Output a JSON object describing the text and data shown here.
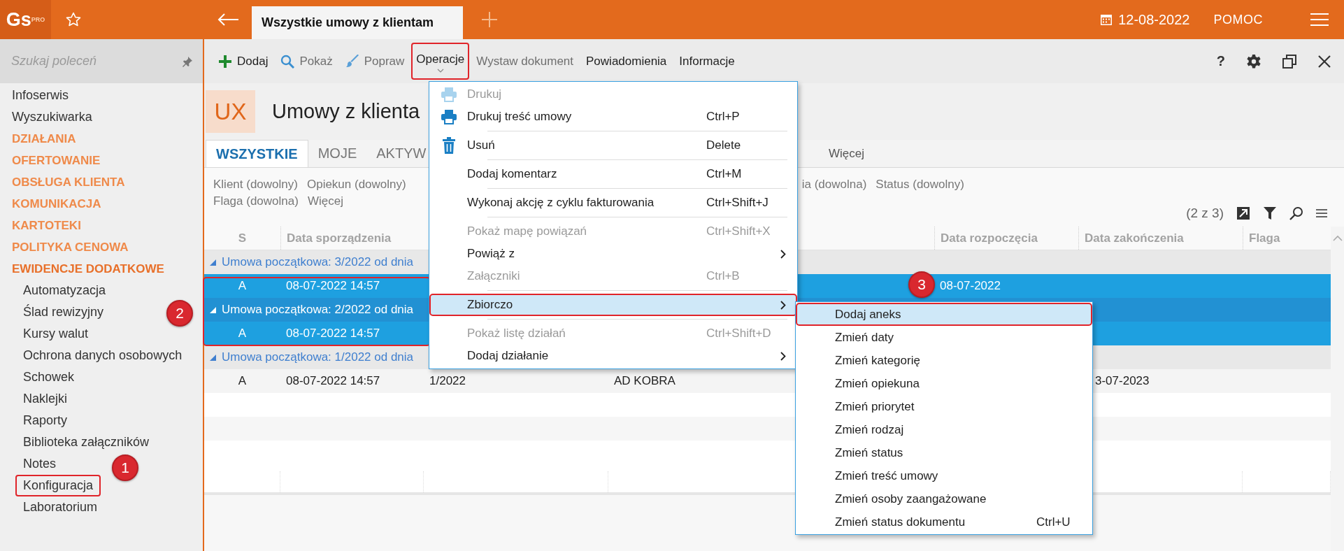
{
  "topbar": {
    "logo": "Gs$^{PRO}$",
    "tab": {
      "title": "Wszystkie umowy z klientam",
      "selected": true
    },
    "date": "12-08-2022",
    "help": "POMOC"
  },
  "sidebar": {
    "search": {
      "placeholder": "Szukaj poleceń"
    },
    "items": [
      {
        "kind": "link",
        "label": "Infoserwis"
      },
      {
        "kind": "link",
        "label": "Wyszukiwarka"
      },
      {
        "kind": "category",
        "label": "DZIAŁANIA",
        "expanded": false
      },
      {
        "kind": "category",
        "label": "OFERTOWANIE",
        "expanded": false
      },
      {
        "kind": "category",
        "label": "OBSŁUGA KLIENTA",
        "expanded": false
      },
      {
        "kind": "category",
        "label": "KOMUNIKACJA",
        "expanded": false
      },
      {
        "kind": "category",
        "label": "KARTOTEKI",
        "expanded": false
      },
      {
        "kind": "category",
        "label": "POLITYKA CENOWA",
        "expanded": false
      },
      {
        "kind": "category",
        "label": "EWIDENCJE DODATKOWE",
        "expanded": true,
        "children": [
          {
            "kind": "link",
            "label": "Automatyzacja",
            "outlined": false
          },
          {
            "kind": "link",
            "label": "Ślad rewizyjny",
            "outlined": false
          },
          {
            "kind": "link",
            "label": "Kursy walut",
            "outlined": false
          },
          {
            "kind": "link",
            "label": "Ochrona danych osobowych",
            "outlined": false
          },
          {
            "kind": "link",
            "label": "Schowek",
            "outlined": false
          },
          {
            "kind": "link",
            "label": "Naklejki",
            "outlined": false
          },
          {
            "kind": "link",
            "label": "Raporty",
            "outlined": false
          },
          {
            "kind": "link",
            "label": "Biblioteka załączników",
            "outlined": false
          },
          {
            "kind": "link",
            "label": "Notes",
            "outlined": false
          },
          {
            "kind": "link",
            "label": "Konfiguracja",
            "outlined": true
          },
          {
            "kind": "link",
            "label": "Laboratorium",
            "outlined": false
          }
        ]
      }
    ]
  },
  "toolbar": {
    "commands": [
      {
        "kind": "icon-command",
        "label": "Dodaj",
        "disabled": false,
        "outlined": false
      },
      {
        "kind": "icon-command",
        "label": "Pokaż",
        "disabled": true,
        "outlined": false
      },
      {
        "kind": "icon-command",
        "label": "Popraw",
        "disabled": true,
        "outlined": false
      },
      {
        "kind": "dropdown",
        "label": "Operacje",
        "disabled": false,
        "outlined": true
      },
      {
        "kind": "command",
        "label": "Wystaw dokument",
        "disabled": true,
        "outlined": false
      },
      {
        "kind": "command",
        "label": "Powiadomienia",
        "disabled": false,
        "outlined": false
      },
      {
        "kind": "command",
        "label": "Informacje",
        "disabled": false,
        "outlined": false
      }
    ],
    "help": "?"
  },
  "header": {
    "badge": "UX",
    "title": "Umowy z klienta"
  },
  "tabs": [
    {
      "label": "WSZYSTKIE",
      "selected": true
    },
    {
      "label": "MOJE",
      "selected": false
    },
    {
      "label": "AKTYW",
      "selected": false
    }
  ],
  "tabs_more": "Więcej",
  "filters": {
    "line_1": [
      "Klient (dowolny)",
      "Opiekun (dowolny)",
      "ia (dowolna)",
      "Status (dowolny)"
    ],
    "line_2": [
      "Flaga (dowolna)",
      "Więcej"
    ],
    "count": "(2 z 3)"
  },
  "table": {
    "columns": [
      "S",
      "Data sporządzenia",
      null,
      null,
      "Data rozpoczęcia",
      "Data zakończenia",
      "Flaga"
    ],
    "rows": [
      {
        "kind": "group",
        "label": "Umowa początkowa: 3/2022 od dnia",
        "selected": false
      },
      {
        "kind": "record",
        "selected": true,
        "cells": [
          "A",
          "08-07-2022 14:57",
          null,
          null,
          "08-07-2022",
          null,
          null
        ]
      },
      {
        "kind": "group",
        "label": "Umowa początkowa: 2/2022 od dnia",
        "selected": true
      },
      {
        "kind": "record",
        "selected": true,
        "cells": [
          "A",
          "08-07-2022 14:57",
          null,
          null,
          null,
          null,
          null
        ]
      },
      {
        "kind": "group",
        "label": "Umowa początkowa: 1/2022 od dnia",
        "selected": false
      },
      {
        "kind": "record",
        "selected": false,
        "cells": [
          "A",
          "08-07-2022 14:57",
          "1/2022",
          "AD KOBRA",
          null,
          "3-07-2023",
          null
        ]
      }
    ]
  },
  "menu": {
    "items": [
      {
        "kind": "item",
        "label": "Drukuj",
        "disabled": true,
        "selected": false,
        "outlined": false
      },
      {
        "kind": "item",
        "label": "Drukuj treść umowy",
        "shortcut": "Ctrl+P",
        "disabled": false,
        "selected": false,
        "outlined": false
      },
      {
        "kind": "separator"
      },
      {
        "kind": "item",
        "label": "Usuń",
        "shortcut": "Delete",
        "disabled": false,
        "selected": false,
        "outlined": false
      },
      {
        "kind": "separator"
      },
      {
        "kind": "item",
        "label": "Dodaj komentarz",
        "shortcut": "Ctrl+M",
        "disabled": false,
        "selected": false,
        "outlined": false
      },
      {
        "kind": "separator"
      },
      {
        "kind": "item",
        "label": "Wykonaj akcję z cyklu fakturowania",
        "shortcut": "Ctrl+Shift+J",
        "disabled": false,
        "selected": false,
        "outlined": false
      },
      {
        "kind": "separator"
      },
      {
        "kind": "item",
        "label": "Pokaż mapę powiązań",
        "shortcut": "Ctrl+Shift+X",
        "disabled": true,
        "selected": false,
        "outlined": false
      },
      {
        "kind": "item",
        "label": "Powiąż z",
        "submenu": true,
        "disabled": false,
        "selected": false,
        "outlined": false
      },
      {
        "kind": "item",
        "label": "Załączniki",
        "shortcut": "Ctrl+B",
        "disabled": true,
        "selected": false,
        "outlined": false
      },
      {
        "kind": "separator"
      },
      {
        "kind": "item",
        "label": "Zbiorczo",
        "submenu": true,
        "disabled": false,
        "selected": true,
        "outlined": true
      },
      {
        "kind": "separator"
      },
      {
        "kind": "item",
        "label": "Pokaż listę działań",
        "shortcut": "Ctrl+Shift+D",
        "disabled": true,
        "selected": false,
        "outlined": false
      },
      {
        "kind": "item",
        "label": "Dodaj działanie",
        "submenu": true,
        "disabled": false,
        "selected": false,
        "outlined": false
      }
    ]
  },
  "submenu": {
    "items": [
      {
        "label": "Dodaj aneks",
        "selected": true,
        "outlined": true
      },
      {
        "label": "Zmień daty",
        "selected": false,
        "outlined": false
      },
      {
        "label": "Zmień kategorię",
        "selected": false,
        "outlined": false
      },
      {
        "label": "Zmień opiekuna",
        "selected": false,
        "outlined": false
      },
      {
        "label": "Zmień priorytet",
        "selected": false,
        "outlined": false
      },
      {
        "label": "Zmień rodzaj",
        "selected": false,
        "outlined": false
      },
      {
        "label": "Zmień status",
        "selected": false,
        "outlined": false
      },
      {
        "label": "Zmień treść umowy",
        "selected": false,
        "outlined": false
      },
      {
        "label": "Zmień osoby zaangażowane",
        "selected": false,
        "outlined": false
      },
      {
        "label": "Zmień status dokumentu",
        "shortcut": "Ctrl+U",
        "selected": false,
        "outlined": false
      }
    ]
  },
  "annotations": {
    "badges": [
      "1",
      "2",
      "3"
    ],
    "selection_frame": true
  }
}
